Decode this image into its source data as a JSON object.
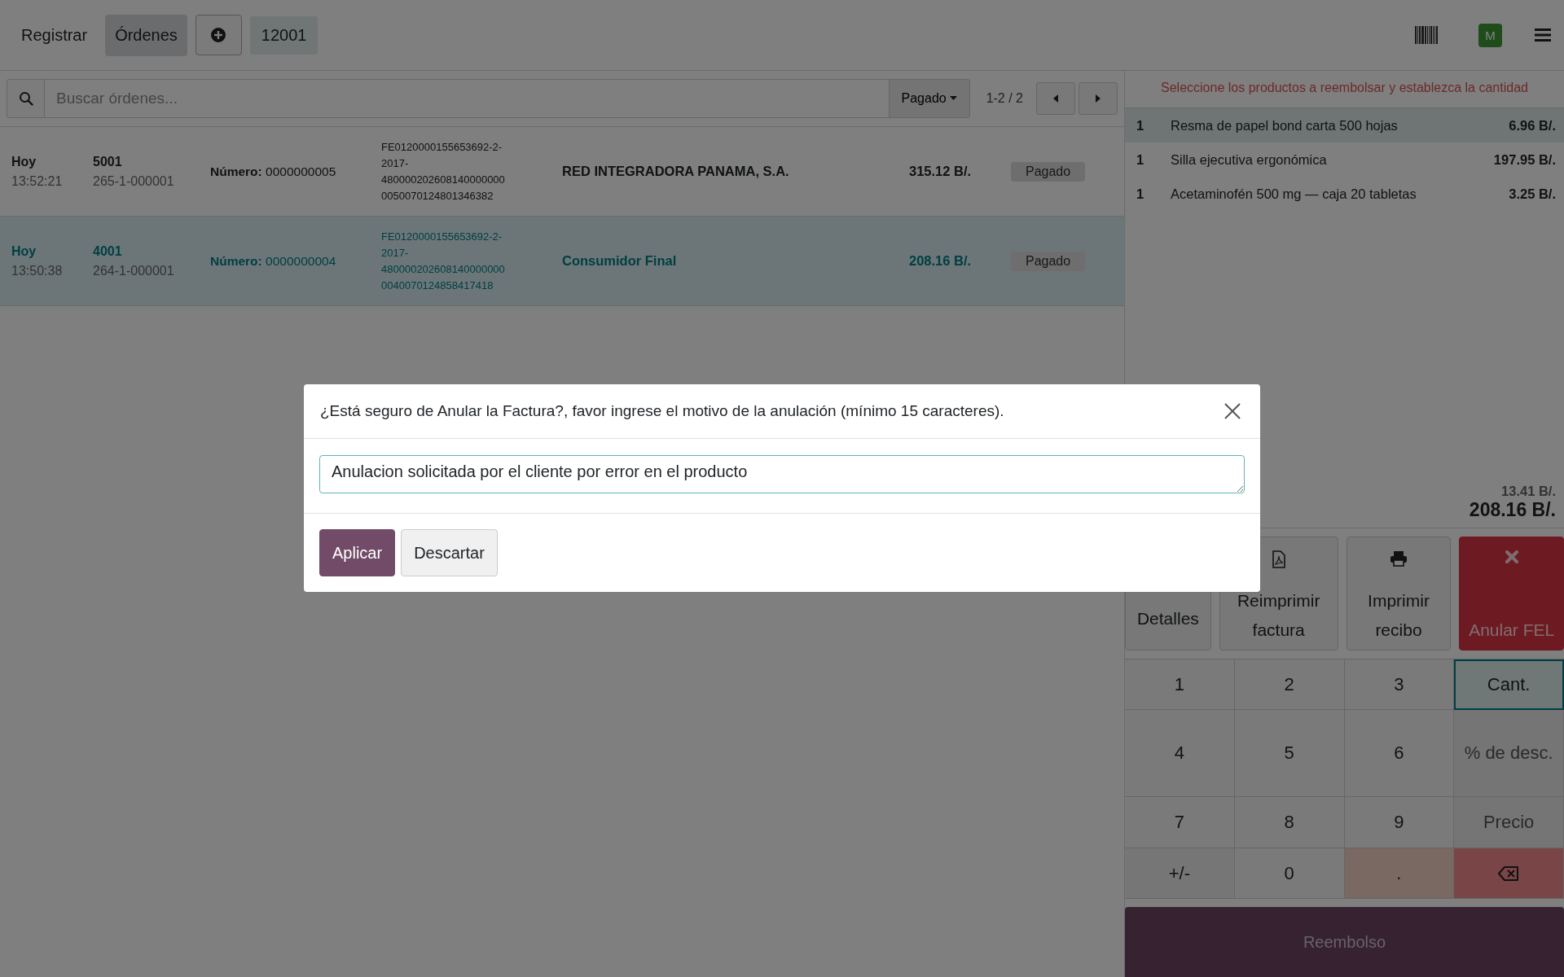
{
  "topbar": {
    "tabs": [
      {
        "label": "Registrar",
        "selected": false
      },
      {
        "label": "Órdenes",
        "selected": true
      }
    ],
    "order_number": "12001",
    "avatar": "M"
  },
  "toolbar": {
    "search": {
      "placeholder": "Buscar órdenes..."
    },
    "filter": "Pagado",
    "pager": "1-2 / 2"
  },
  "orders": [
    {
      "date": "Hoy",
      "time": "13:52:21",
      "order": "5001",
      "receipt": "265-1-000001",
      "number_label": "Número:",
      "number": "0000000005",
      "fe_code": "FE0120000155653692-2-2017-4800002026081400000000050070124801346382",
      "customer": "RED INTEGRADORA PANAMA, S.A.",
      "total": "315.12 B/.",
      "status": "Pagado",
      "selected": false
    },
    {
      "date": "Hoy",
      "time": "13:50:38",
      "order": "4001",
      "receipt": "264-1-000001",
      "number_label": "Número:",
      "number": "0000000004",
      "fe_code": "FE0120000155653692-2-2017-4800002026081400000000040070124858417418",
      "customer": "Consumidor Final",
      "total": "208.16 B/.",
      "status": "Pagado",
      "selected": true
    }
  ],
  "refund_panel": {
    "message": "Seleccione los productos a reembolsar y establezca la cantidad",
    "lines": [
      {
        "qty": "1",
        "name": "Resma de papel bond carta 500 hojas",
        "price": "6.96 B/.",
        "selected": true
      },
      {
        "qty": "1",
        "name": "Silla ejecutiva ergonómica",
        "price": "197.95 B/.",
        "selected": false
      },
      {
        "qty": "1",
        "name": "Acetaminofén 500 mg — caja 20 tabletas",
        "price": "3.25 B/.",
        "selected": false
      }
    ],
    "subtotal": "13.41 B/.",
    "total": "208.16 B/.",
    "actions": [
      {
        "label": "Detalles",
        "kind": "details"
      },
      {
        "label": "Reimprimir factura",
        "kind": "reprint"
      },
      {
        "label": "Imprimir recibo",
        "kind": "print"
      },
      {
        "label": "Anular FEL",
        "kind": "void"
      }
    ],
    "keys": [
      {
        "label": "1",
        "kind": "digit",
        "selected": false
      },
      {
        "label": "2",
        "kind": "digit",
        "selected": false
      },
      {
        "label": "3",
        "kind": "digit",
        "selected": false
      },
      {
        "label": "Cant.",
        "kind": "mode",
        "selected": true
      },
      {
        "label": "4",
        "kind": "digit",
        "selected": false
      },
      {
        "label": "5",
        "kind": "digit",
        "selected": false
      },
      {
        "label": "6",
        "kind": "digit",
        "selected": false
      },
      {
        "label": "% de desc.",
        "kind": "mode",
        "selected": false
      },
      {
        "label": "7",
        "kind": "digit",
        "selected": false
      },
      {
        "label": "8",
        "kind": "digit",
        "selected": false
      },
      {
        "label": "9",
        "kind": "digit",
        "selected": false
      },
      {
        "label": "Precio",
        "kind": "mode",
        "selected": false
      },
      {
        "label": "+/-",
        "kind": "sign",
        "selected": false
      },
      {
        "label": "0",
        "kind": "digit",
        "selected": false
      },
      {
        "label": ".",
        "kind": "decimal",
        "selected": false
      },
      {
        "kind": "backspace",
        "selected": false
      }
    ],
    "refund_button": "Reembolso"
  },
  "dialog": {
    "title": "¿Está seguro de Anular la Factura?, favor ingrese el motivo de la anulación (mínimo 15 caracteres).",
    "value": "Anulacion solicitada por el cliente por error en el producto",
    "buttons": [
      {
        "label": "Aplicar",
        "kind": "primary"
      },
      {
        "label": "Descartar",
        "kind": "secondary"
      }
    ]
  }
}
